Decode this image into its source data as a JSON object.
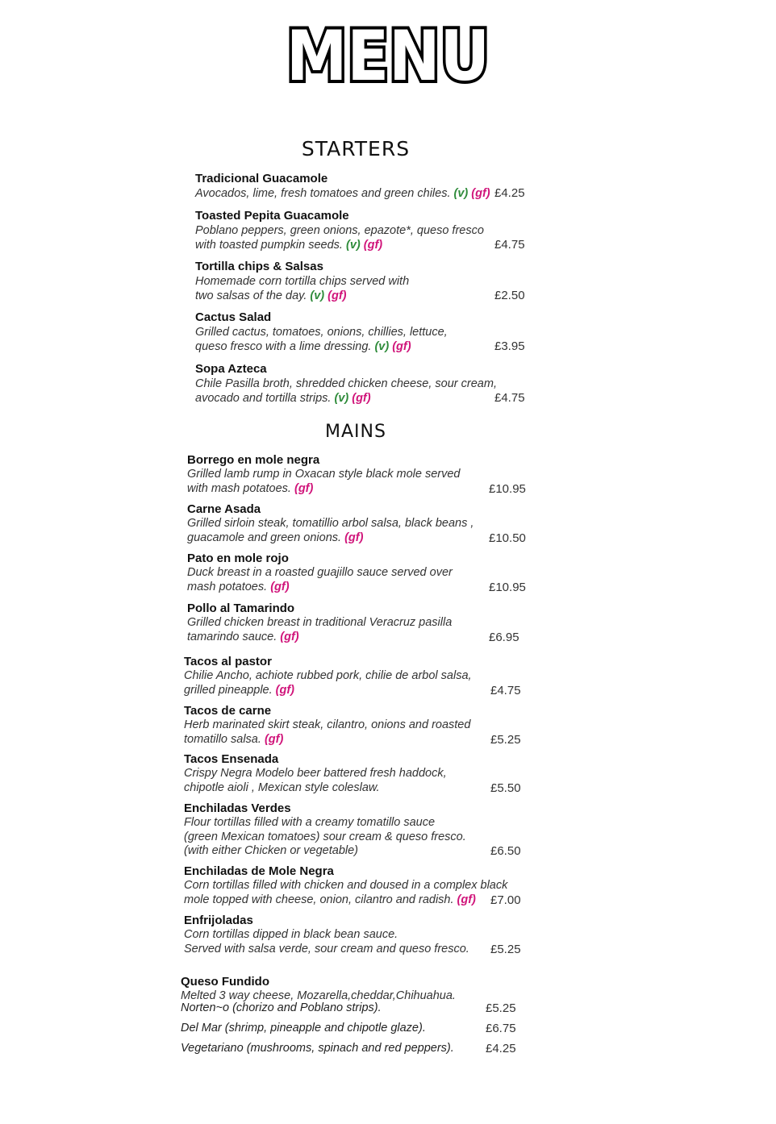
{
  "title": "MENU",
  "sections": {
    "starters": "STARTERS",
    "mains": "MAINS"
  },
  "starters": [
    {
      "name": "Tradicional Guacamole",
      "lines": [
        "Avocados, lime, fresh tomatoes and green chiles."
      ],
      "v": "(v)",
      "gf": "(gf)",
      "price": "£4.25"
    },
    {
      "name": "Toasted Pepita Guacamole",
      "lines": [
        "Poblano peppers, green onions, epazote*, queso fresco",
        "with toasted pumpkin seeds."
      ],
      "v": "(v)",
      "gf": "(gf)",
      "price": "£4.75"
    },
    {
      "name": "Tortilla chips & Salsas",
      "lines": [
        "Homemade corn tortilla chips served with",
        "two salsas of the day."
      ],
      "v": "(v)",
      "gf": "(gf)",
      "price": "£2.50"
    },
    {
      "name": "Cactus Salad",
      "lines": [
        "Grilled cactus, tomatoes, onions, chillies, lettuce,",
        "queso fresco with a lime dressing."
      ],
      "v": "(v)",
      "gf": "(gf)",
      "price": "£3.95"
    },
    {
      "name": "Sopa Azteca",
      "lines": [
        "Chile Pasilla broth, shredded chicken cheese, sour cream,",
        "avocado and tortilla strips."
      ],
      "v": "(v)",
      "gf": "(gf)",
      "price": "£4.75"
    }
  ],
  "mains_a": [
    {
      "name": "Borrego en mole negra",
      "lines": [
        "Grilled lamb rump in Oxacan style black mole served",
        "with mash potatoes."
      ],
      "gf": "(gf)",
      "price": "£10.95"
    },
    {
      "name": "Carne Asada",
      "lines": [
        "Grilled sirloin steak, tomatillio arbol salsa, black beans ,",
        "guacamole and green onions."
      ],
      "gf": "(gf)",
      "price": "£10.50"
    },
    {
      "name": "Pato en mole rojo",
      "lines": [
        "Duck breast in a roasted guajillo sauce served over",
        "mash potatoes."
      ],
      "gf": "(gf)",
      "price": "£10.95"
    },
    {
      "name": "Pollo al Tamarindo",
      "lines": [
        "Grilled chicken breast in traditional Veracruz pasilla",
        "tamarindo sauce."
      ],
      "gf": "(gf)",
      "price": "£6.95"
    }
  ],
  "mains_b": [
    {
      "name": "Tacos al pastor",
      "lines": [
        "Chilie Ancho, achiote rubbed pork, chilie de arbol salsa,",
        "grilled pineapple."
      ],
      "gf": "(gf)",
      "price": "£4.75"
    },
    {
      "name": "Tacos de carne",
      "lines": [
        "Herb marinated skirt steak, cilantro, onions and roasted",
        "tomatillo salsa."
      ],
      "gf": "(gf)",
      "price": "£5.25"
    },
    {
      "name": "Tacos Ensenada",
      "lines": [
        "Crispy Negra Modelo beer battered fresh haddock,",
        "chipotle aioli , Mexican style coleslaw."
      ],
      "gf": "",
      "price": "£5.50"
    },
    {
      "name": "Enchiladas Verdes",
      "lines": [
        "Flour tortillas filled with a creamy tomatillo sauce",
        "(green Mexican tomatoes) sour cream & queso fresco.",
        "(with either Chicken or vegetable)"
      ],
      "gf": "",
      "price": "£6.50"
    },
    {
      "name": "Enchiladas de Mole Negra",
      "lines": [
        "Corn tortillas filled with chicken and doused in a complex black",
        "mole topped with cheese, onion, cilantro and radish."
      ],
      "gf": "(gf)",
      "price": "£7.00"
    },
    {
      "name": "Enfrijoladas",
      "lines": [
        "Corn tortillas dipped in black bean sauce.",
        "Served with salsa verde, sour cream and queso fresco."
      ],
      "gf": "",
      "price": "£5.25"
    }
  ],
  "queso": {
    "name": "Queso Fundido",
    "intro": "Melted 3 way cheese, Mozarella,cheddar,Chihuahua.",
    "options": [
      {
        "label": "Norten~o (chorizo and Poblano strips).",
        "price": "£5.25"
      },
      {
        "label": "Del Mar (shrimp, pineapple and chipotle glaze).",
        "price": "£6.75"
      },
      {
        "label": "Vegetariano (mushrooms, spinach and red peppers).",
        "price": "£4.25"
      }
    ]
  }
}
